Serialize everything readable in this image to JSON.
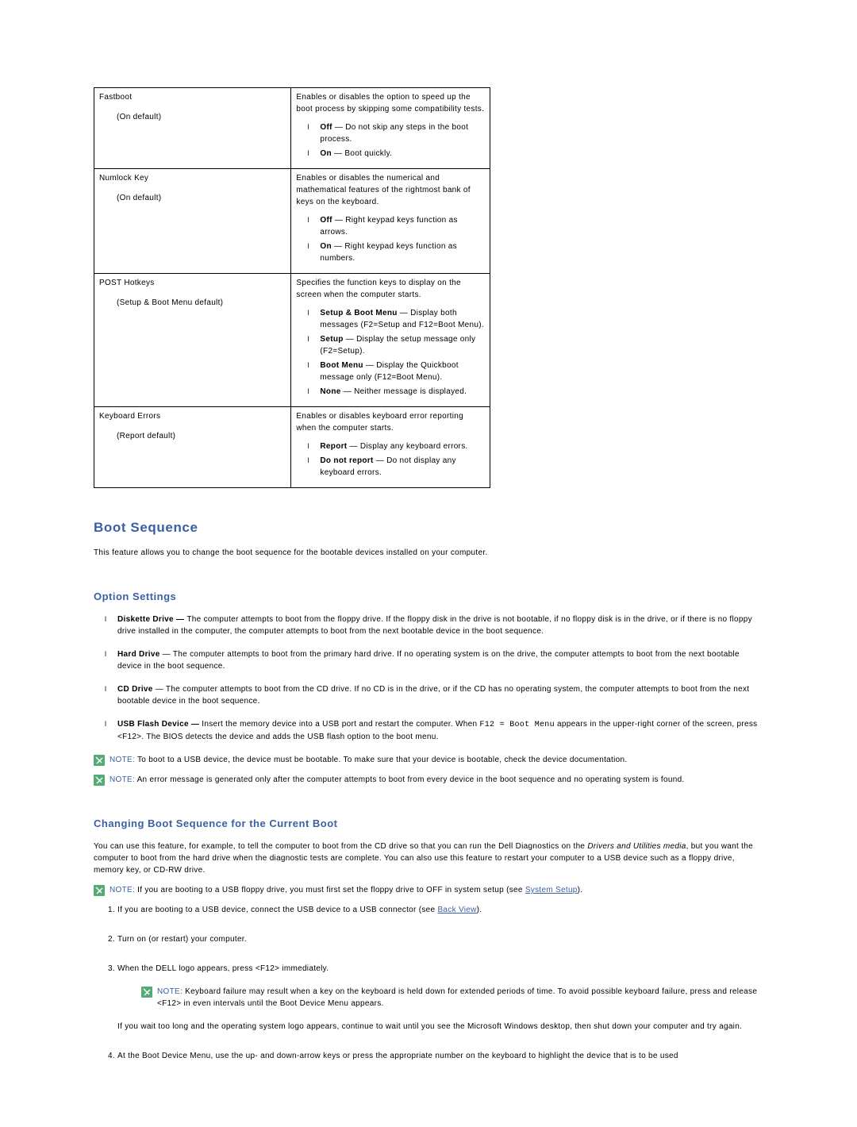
{
  "table": {
    "rows": [
      {
        "title": "Fastboot",
        "default": "(On default)",
        "desc": "Enables or disables the option to speed up the boot process by skipping some compatibility tests.",
        "options": [
          {
            "label": "Off",
            "detail": " — Do not skip any steps in the boot process."
          },
          {
            "label": "On",
            "detail": " — Boot quickly."
          }
        ]
      },
      {
        "title": "Numlock Key",
        "default": "(On default)",
        "desc": "Enables or disables the numerical and mathematical features of the rightmost bank of keys on the keyboard.",
        "options": [
          {
            "label": "Off",
            "detail": " — Right keypad keys function as arrows."
          },
          {
            "label": "On",
            "detail": " — Right keypad keys function as numbers."
          }
        ]
      },
      {
        "title": "POST Hotkeys",
        "default": "(Setup & Boot Menu default)",
        "desc": "Specifies the function keys to display on the screen when the computer starts.",
        "options": [
          {
            "label": "Setup & Boot Menu",
            "detail": " — Display both messages (F2=Setup and F12=Boot Menu)."
          },
          {
            "label": "Setup",
            "detail": " — Display the setup message only (F2=Setup)."
          },
          {
            "label": "Boot Menu",
            "detail": " — Display the Quickboot message only (F12=Boot Menu)."
          },
          {
            "label": "None",
            "detail": " — Neither message is displayed."
          }
        ]
      },
      {
        "title": "Keyboard Errors",
        "default": "(Report default)",
        "desc": "Enables or disables keyboard error reporting when the computer starts.",
        "options": [
          {
            "label": "Report",
            "detail": " — Display any keyboard errors."
          },
          {
            "label": "Do not report",
            "detail": " — Do not display any keyboard errors."
          }
        ]
      }
    ]
  },
  "s1": {
    "heading": "Boot Sequence",
    "intro": "This feature allows you to change the boot sequence for the bootable devices installed on your computer."
  },
  "s2": {
    "heading": "Option Settings",
    "items": [
      {
        "label": "Diskette Drive — ",
        "detail": "The computer attempts to boot from the floppy drive. If the floppy disk in the drive is not bootable, if no floppy disk is in the drive, or if there is no floppy drive installed in the computer, the computer attempts to boot from the next bootable device in the boot sequence."
      },
      {
        "label": "Hard Drive",
        "detail": " — The computer attempts to boot from the primary hard drive. If no operating system is on the drive, the computer attempts to boot from the next bootable device in the boot sequence."
      },
      {
        "label": "CD Drive",
        "detail": " — The computer attempts to boot from the CD drive. If no CD is in the drive, or if the CD has no operating system, the computer attempts to boot from the next bootable device in the boot sequence."
      },
      {
        "label": "USB Flash Device —",
        "detail_pre": " Insert the memory device into a USB port and restart the computer. When ",
        "mono": "F12 = Boot Menu",
        "detail_post": " appears in the upper-right corner of the screen, press <F12>. The BIOS detects the device and adds the USB flash option to the boot menu."
      }
    ],
    "note1": " To boot to a USB device, the device must be bootable. To make sure that your device is bootable, check the device documentation.",
    "note2": " An error message is generated only after the computer attempts to boot from every device in the boot sequence and no operating system is found."
  },
  "s3": {
    "heading": "Changing Boot Sequence for the Current Boot",
    "para_pre": "You can use this feature, for example, to tell the computer to boot from the CD drive so that you can run the Dell Diagnostics on the ",
    "para_em": "Drivers and Utilities media",
    "para_post": ", but you want the computer to boot from the hard drive when the diagnostic tests are complete. You can also use this feature to restart your computer to a USB device such as a floppy drive, memory key, or CD-RW drive.",
    "note3_pre": " If you are booting to a USB floppy drive, you must first set the floppy drive to OFF in system setup (see ",
    "note3_link": "System Setup",
    "note3_post": ").",
    "step1_pre": "If you are booting to a USB device, connect the USB device to a USB connector (see ",
    "step1_link": "Back View",
    "step1_post": ").",
    "step2": "Turn on (or restart) your computer.",
    "step3": "When the DELL logo appears, press <F12> immediately.",
    "step3_note": " Keyboard failure may result when a key on the keyboard is held down for extended periods of time. To avoid possible keyboard failure, press and release <F12> in even intervals until the Boot Device Menu appears.",
    "step3_after": "If you wait too long and the operating system logo appears, continue to wait until you see the Microsoft Windows desktop, then shut down your computer and try again.",
    "step4": "At the Boot Device Menu, use the up- and down-arrow keys or press the appropriate number on the keyboard to highlight the device that is to be used"
  },
  "labels": {
    "note": "NOTE:"
  }
}
